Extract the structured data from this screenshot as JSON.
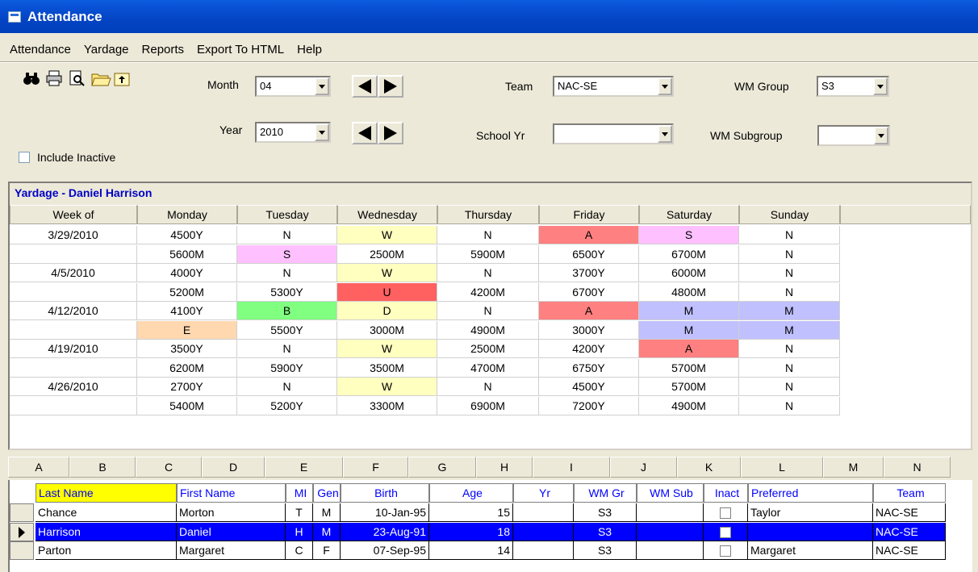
{
  "window": {
    "title": "Attendance"
  },
  "menu": [
    "Attendance",
    "Yardage",
    "Reports",
    "Export To HTML",
    "Help"
  ],
  "toolbar_icons": [
    "binoculars-icon",
    "printer-icon",
    "print-preview-icon",
    "folder-open-icon",
    "folder-up-icon"
  ],
  "filters": {
    "month_label": "Month",
    "month_value": "04",
    "year_label": "Year",
    "year_value": "2010",
    "team_label": "Team",
    "team_value": "NAC-SE",
    "school_yr_label": "School Yr",
    "school_yr_value": "",
    "wm_group_label": "WM Group",
    "wm_group_value": "S3",
    "wm_subgroup_label": "WM Subgroup",
    "wm_subgroup_value": "",
    "include_inactive_label": "Include Inactive"
  },
  "yardage": {
    "title": "Yardage - Daniel Harrison",
    "headers": [
      "Week of",
      "Monday",
      "Tuesday",
      "Wednesday",
      "Thursday",
      "Friday",
      "Saturday",
      "Sunday"
    ],
    "rows": [
      [
        "3/29/2010",
        "4500Y",
        "N",
        "W",
        "N",
        "A",
        "S",
        "N"
      ],
      [
        "",
        "5600M",
        "S",
        "2500M",
        "5900M",
        "6500Y",
        "6700M",
        "N"
      ],
      [
        "4/5/2010",
        "4000Y",
        "N",
        "W",
        "N",
        "3700Y",
        "6000M",
        "N"
      ],
      [
        "",
        "5200M",
        "5300Y",
        "U",
        "4200M",
        "6700Y",
        "4800M",
        "N"
      ],
      [
        "4/12/2010",
        "4100Y",
        "B",
        "D",
        "N",
        "A",
        "M",
        "M"
      ],
      [
        "",
        "E",
        "5500Y",
        "3000M",
        "4900M",
        "3000Y",
        "M",
        "M"
      ],
      [
        "4/19/2010",
        "3500Y",
        "N",
        "W",
        "2500M",
        "4200Y",
        "A",
        "N"
      ],
      [
        "",
        "6200M",
        "5900Y",
        "3500M",
        "4700M",
        "6750Y",
        "5700M",
        "N"
      ],
      [
        "4/26/2010",
        "2700Y",
        "N",
        "W",
        "N",
        "4500Y",
        "5700M",
        "N"
      ],
      [
        "",
        "5400M",
        "5200Y",
        "3300M",
        "6900M",
        "7200Y",
        "4900M",
        "N"
      ]
    ],
    "code_colors": {
      "W": "#FFFFC0",
      "A": "#FF8080",
      "S": "#FFC0FF",
      "U": "#FF6060",
      "B": "#80FF80",
      "D": "#FFFFC0",
      "M": "#C0C0FF",
      "E": "#FFD8B0"
    }
  },
  "column_letters": [
    "A",
    "B",
    "C",
    "D",
    "E",
    "F",
    "G",
    "H",
    "I",
    "J",
    "K",
    "L",
    "M",
    "N"
  ],
  "roster": {
    "headers": [
      "Last Name",
      "First Name",
      "MI",
      "Gen",
      "Birth",
      "Age",
      "Yr",
      "WM Gr",
      "WM Sub",
      "Inact",
      "Preferred",
      "Team"
    ],
    "rows": [
      {
        "last": "Chance",
        "first": "Morton",
        "mi": "T",
        "gen": "M",
        "birth": "10-Jan-95",
        "age": "15",
        "yr": "",
        "wmgr": "S3",
        "wmsub": "",
        "preferred": "Taylor",
        "team": "NAC-SE",
        "selected": false
      },
      {
        "last": "Harrison",
        "first": "Daniel",
        "mi": "H",
        "gen": "M",
        "birth": "23-Aug-91",
        "age": "18",
        "yr": "",
        "wmgr": "S3",
        "wmsub": "",
        "preferred": "",
        "team": "NAC-SE",
        "selected": true
      },
      {
        "last": "Parton",
        "first": "Margaret",
        "mi": "C",
        "gen": "F",
        "birth": "07-Sep-95",
        "age": "14",
        "yr": "",
        "wmgr": "S3",
        "wmsub": "",
        "preferred": "Margaret",
        "team": "NAC-SE",
        "selected": false
      }
    ]
  }
}
